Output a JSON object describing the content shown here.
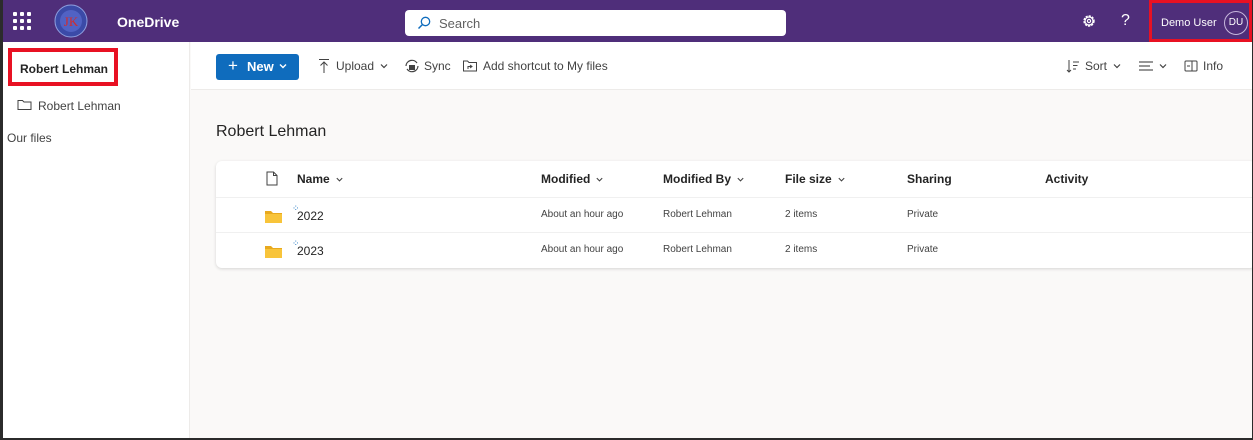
{
  "app": {
    "name": "OneDrive",
    "logo_text": "JK",
    "search_placeholder": "Search",
    "help": "?",
    "user": {
      "name": "Demo User",
      "initials": "DU"
    }
  },
  "nav": {
    "selected": "Robert Lehman",
    "folder": "Robert Lehman",
    "our_files": "Our files"
  },
  "commands": {
    "new": "New",
    "upload": "Upload",
    "sync": "Sync",
    "shortcut": "Add shortcut to My files",
    "sort": "Sort",
    "info": "Info"
  },
  "page": {
    "title": "Robert Lehman"
  },
  "table": {
    "columns": {
      "name": "Name",
      "modified": "Modified",
      "modified_by": "Modified By",
      "file_size": "File size",
      "sharing": "Sharing",
      "activity": "Activity"
    },
    "rows": [
      {
        "name": "2022",
        "modified": "About an hour ago",
        "modified_by": "Robert Lehman",
        "size": "2 items",
        "sharing": "Private"
      },
      {
        "name": "2023",
        "modified": "About an hour ago",
        "modified_by": "Robert Lehman",
        "size": "2 items",
        "sharing": "Private"
      }
    ]
  },
  "colors": {
    "suite_bar": "#4f2e7a",
    "accent": "#0f6cbd",
    "highlight": "#e81123",
    "folder": "#f8c43a"
  }
}
